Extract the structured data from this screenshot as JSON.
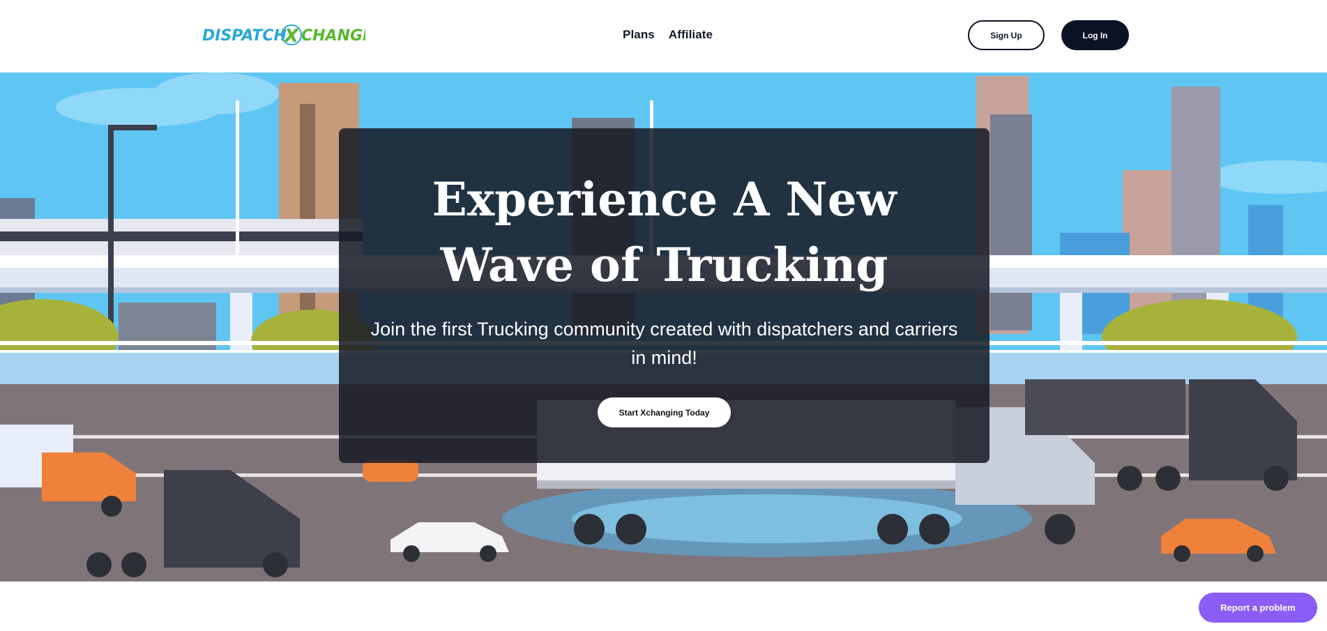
{
  "header": {
    "logo_text": "DISPATCH X CHANGE",
    "nav": [
      {
        "label": "Plans"
      },
      {
        "label": "Affiliate"
      }
    ],
    "signup_label": "Sign Up",
    "login_label": "Log In"
  },
  "hero": {
    "headline_line1": "Experience A New",
    "headline_line2": "Wave of Trucking",
    "subtitle": "Join the first Trucking community created with dispatchers and carriers in mind!",
    "cta_label": "Start Xchanging Today"
  },
  "footer_widget": {
    "report_label": "Report a problem"
  },
  "colors": {
    "brand_dark": "#0b1226",
    "logo_blue": "#2aa7d8",
    "logo_green": "#58b82f",
    "report_purple": "#8b5cf6",
    "sky": "#5fc6f4"
  }
}
